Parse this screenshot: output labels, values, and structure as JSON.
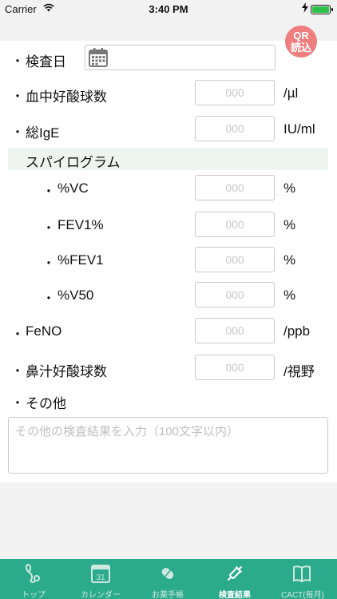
{
  "status_bar": {
    "carrier": "Carrier",
    "time": "3:40 PM"
  },
  "qr_button": {
    "line1": "QR",
    "line2": "読込"
  },
  "form": {
    "exam_date": {
      "label": "検査日"
    },
    "blood_eosinophil": {
      "label": "血中好酸球数",
      "placeholder": "000",
      "unit": "/µl"
    },
    "total_ige": {
      "label": "総IgE",
      "placeholder": "000",
      "unit": "IU/ml"
    },
    "spirogram": {
      "title": "スパイログラム",
      "vc": {
        "label": "%VC",
        "placeholder": "000",
        "unit": "%"
      },
      "fev1pct": {
        "label": "FEV1%",
        "placeholder": "000",
        "unit": "%"
      },
      "pfev1": {
        "label": "%FEV1",
        "placeholder": "000",
        "unit": "%"
      },
      "v50": {
        "label": "%V50",
        "placeholder": "000",
        "unit": "%"
      }
    },
    "feno": {
      "label": "FeNO",
      "placeholder": "000",
      "unit": "/ppb"
    },
    "nasal_eosinophil": {
      "label": "鼻汁好酸球数",
      "placeholder": "000",
      "unit": "/視野"
    },
    "other": {
      "label": "その他",
      "placeholder": "その他の検査結果を入力（100文字以内）"
    }
  },
  "bullet": "・",
  "tabs": [
    {
      "label": "トップ",
      "icon": "stethoscope-icon",
      "active": false
    },
    {
      "label": "カレンダー",
      "icon": "calendar-icon",
      "active": false
    },
    {
      "label": "お薬手帳",
      "icon": "pill-icon",
      "active": false
    },
    {
      "label": "検査結果",
      "icon": "syringe-icon",
      "active": true
    },
    {
      "label": "CACT(毎月)",
      "icon": "book-icon",
      "active": false
    }
  ],
  "colors": {
    "tabbar": "#2bab8c",
    "qr": "#ef7e7e",
    "section": "#eef4ef"
  }
}
